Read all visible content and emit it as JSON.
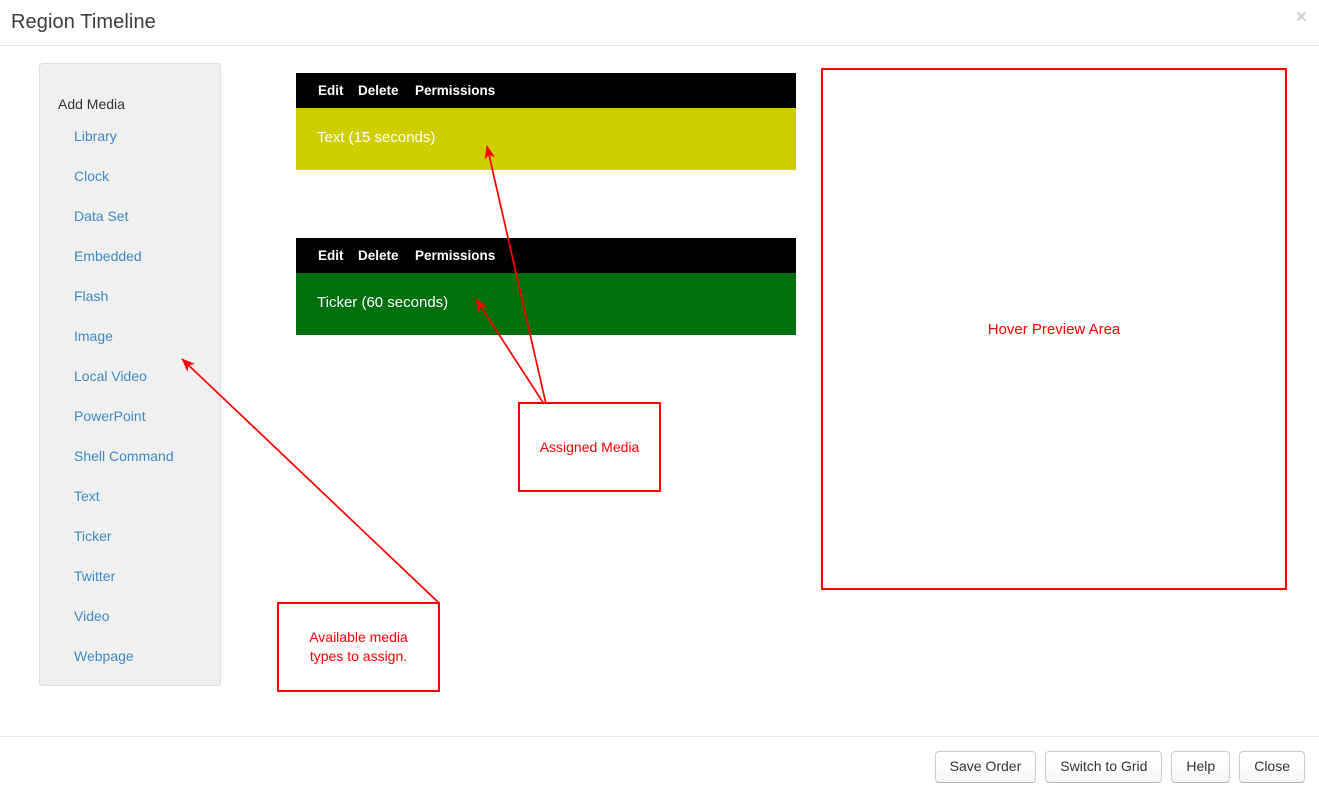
{
  "window": {
    "title": "Region Timeline",
    "close_icon": "close-x-icon",
    "close_label": "×"
  },
  "sidebar": {
    "heading": "Add Media",
    "items": [
      {
        "label": "Library"
      },
      {
        "label": "Clock"
      },
      {
        "label": "Data Set"
      },
      {
        "label": "Embedded"
      },
      {
        "label": "Flash"
      },
      {
        "label": "Image"
      },
      {
        "label": "Local Video"
      },
      {
        "label": "PowerPoint"
      },
      {
        "label": "Shell Command"
      },
      {
        "label": "Text"
      },
      {
        "label": "Ticker"
      },
      {
        "label": "Twitter"
      },
      {
        "label": "Video"
      },
      {
        "label": "Webpage"
      }
    ]
  },
  "timeline": {
    "toolbar_labels": {
      "edit": "Edit",
      "delete": "Delete",
      "permissions": "Permissions"
    },
    "media": [
      {
        "label": "Text (15 seconds)",
        "type": "Text",
        "duration": "15 seconds",
        "color": "#cfcf00"
      },
      {
        "label": "Ticker (60 seconds)",
        "type": "Ticker",
        "duration": "60 seconds",
        "color": "#00700d"
      }
    ]
  },
  "annotations": {
    "color": "#ff0000",
    "assigned_media": "Assigned Media",
    "available_media_line1": "Available media",
    "available_media_line2": "types to assign.",
    "hover_preview": "Hover Preview Area"
  },
  "footer": {
    "buttons": [
      {
        "label": "Save Order"
      },
      {
        "label": "Switch to Grid"
      },
      {
        "label": "Help"
      },
      {
        "label": "Close"
      }
    ]
  }
}
